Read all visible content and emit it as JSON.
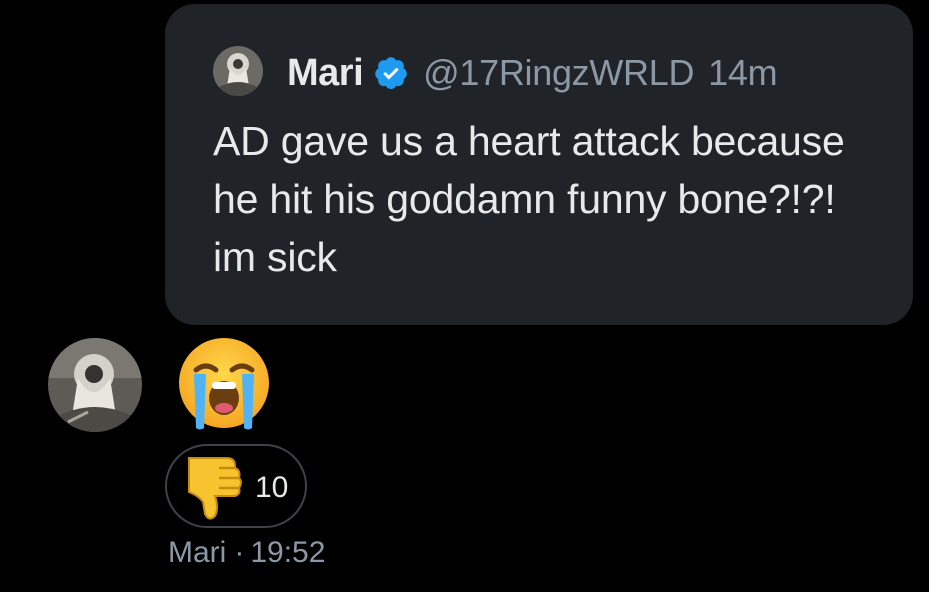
{
  "quoted_tweet": {
    "author_name": "Mari",
    "verified": true,
    "handle": "@17RingzWRLD",
    "time_ago": "14m",
    "text": "AD gave us a heart attack because he hit his goddamn funny bone?!?! im sick",
    "avatar_icon": "user-avatar-icon"
  },
  "message": {
    "emoji": "loudly-crying-face",
    "avatar_icon": "user-avatar-icon",
    "reaction": {
      "emoji": "thumbs-down",
      "count": "10"
    },
    "sender": "Mari",
    "separator": "·",
    "time": "19:52"
  },
  "colors": {
    "background": "#000000",
    "card": "#202327",
    "primary_text": "#e7e9ea",
    "secondary_text": "#8b98a5",
    "verified_blue": "#1d9bf0",
    "pill_border": "#3d4349"
  }
}
